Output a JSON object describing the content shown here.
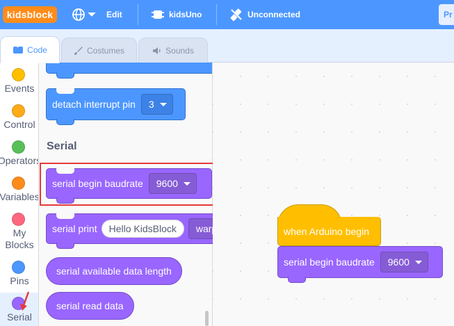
{
  "topbar": {
    "logo": "kidsblock",
    "globe_icon": "globe-icon",
    "edit_label": "Edit",
    "device_icon": "chip-icon",
    "device_label": "kidsUno",
    "connection_icon": "unplugged-icon",
    "connection_label": "Unconnected",
    "right_button_label": "Pr"
  },
  "tabs": [
    {
      "label": "Code",
      "icon": "code-icon",
      "active": true
    },
    {
      "label": "Costumes",
      "icon": "brush-icon",
      "active": false
    },
    {
      "label": "Sounds",
      "icon": "speaker-icon",
      "active": false
    }
  ],
  "categories": [
    {
      "label": "Events",
      "color": "#ffbf00"
    },
    {
      "label": "Control",
      "color": "#ffab19"
    },
    {
      "label": "Operators",
      "color": "#59c059"
    },
    {
      "label": "Variables",
      "color": "#ff8c1a"
    },
    {
      "label": "My",
      "label2": "Blocks",
      "color": "#ff6680"
    },
    {
      "label": "Pins",
      "color": "#4c97ff"
    },
    {
      "label": "Serial",
      "color": "#9966ff"
    }
  ],
  "palette": {
    "detach_block": {
      "text": "detach interrupt pin",
      "value": "3"
    },
    "section_title": "Serial",
    "serial_begin": {
      "text": "serial begin baudrate",
      "value": "9600"
    },
    "serial_print": {
      "text": "serial print",
      "input": "Hello KidsBlock",
      "mode": "warp"
    },
    "available": "serial available data length",
    "read": "serial read data"
  },
  "workspace": {
    "hat_block": "when Arduino begin",
    "begin_block": {
      "text": "serial begin baudrate",
      "value": "9600"
    }
  },
  "colors": {
    "accent": "#4c97ff",
    "serial": "#9966ff",
    "events": "#ffbf00",
    "highlight": "#e53b3b"
  }
}
